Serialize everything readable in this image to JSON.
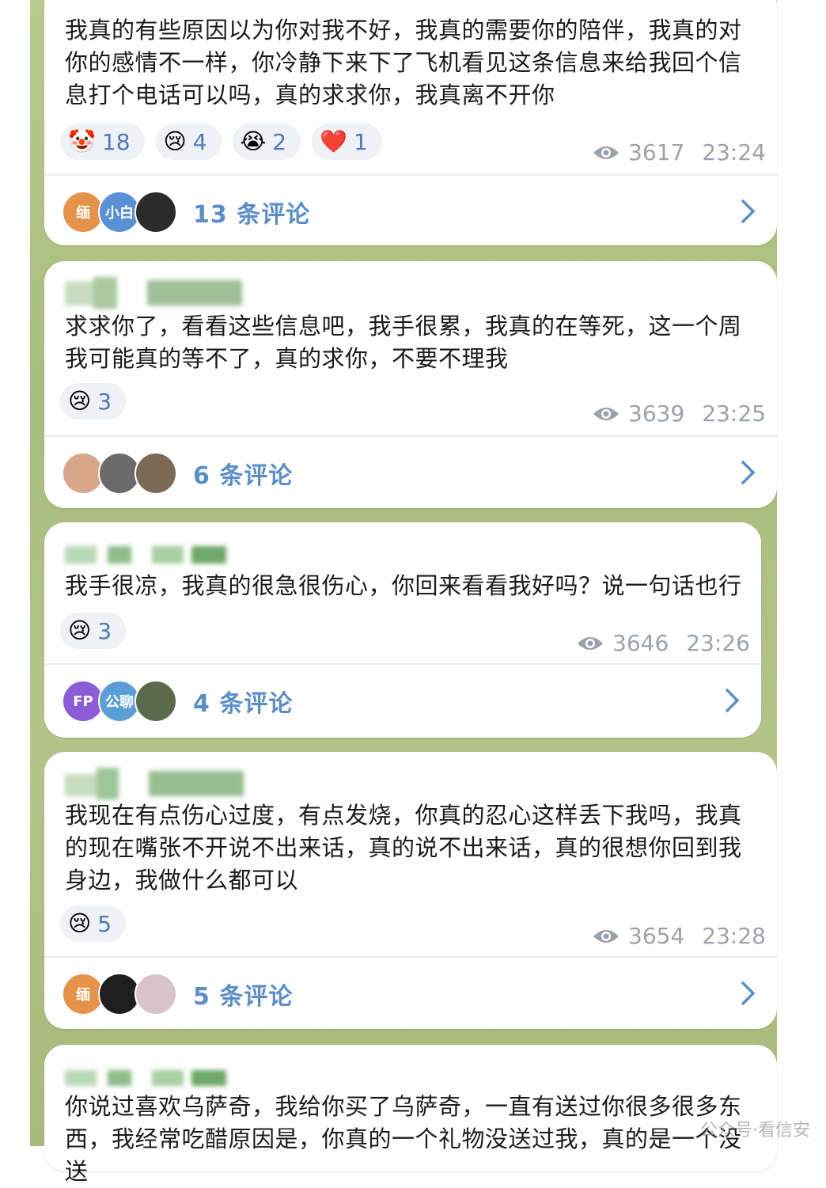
{
  "posts": [
    {
      "message": "我真的有些原因以为你对我不好，我真的需要你的陪伴，我真的对你的感情不一样，你冷静下来下了飞机看见这条信息来给我回个信息打个电话可以吗，真的求求你，我真离不开你",
      "reactions": [
        {
          "emoji": "🤡",
          "count": "18"
        },
        {
          "emoji": "😢",
          "count": "4"
        },
        {
          "emoji": "😭",
          "count": "2"
        },
        {
          "emoji": "❤️",
          "count": "1"
        }
      ],
      "views": "3617",
      "time": "23:24",
      "comments_label": "13 条评论",
      "avatars": [
        {
          "text": "缅",
          "color": "#e7924a"
        },
        {
          "text": "小白",
          "color": "#5b8fd6"
        },
        {
          "text": "",
          "color": "#2b2b2b"
        }
      ]
    },
    {
      "message": "求求你了，看看这些信息吧，我手很累，我真的在等死，这一个周我可能真的等不了，真的求你，不要不理我",
      "reactions": [
        {
          "emoji": "😢",
          "count": "3"
        }
      ],
      "views": "3639",
      "time": "23:25",
      "comments_label": "6 条评论",
      "avatars": [
        {
          "text": "",
          "color": "#d9a58b"
        },
        {
          "text": "",
          "color": "#6a6a6a"
        },
        {
          "text": "",
          "color": "#7b6a55"
        }
      ]
    },
    {
      "message": "我手很凉，我真的很急很伤心，你回来看看我好吗？说一句话也行",
      "reactions": [
        {
          "emoji": "😢",
          "count": "3"
        }
      ],
      "views": "3646",
      "time": "23:26",
      "comments_label": "4 条评论",
      "avatars": [
        {
          "text": "FP",
          "color": "#8c5bd6"
        },
        {
          "text": "公聊",
          "color": "#5b9fd6"
        },
        {
          "text": "",
          "color": "#5a6a4a"
        }
      ]
    },
    {
      "message": "我现在有点伤心过度，有点发烧，你真的忍心这样丢下我吗，我真的现在嘴张不开说不出来话，真的说不出来话，真的很想你回到我身边，我做什么都可以",
      "reactions": [
        {
          "emoji": "😢",
          "count": "5"
        }
      ],
      "views": "3654",
      "time": "23:28",
      "comments_label": "5 条评论",
      "avatars": [
        {
          "text": "缅",
          "color": "#e7924a"
        },
        {
          "text": "",
          "color": "#1f1f1f"
        },
        {
          "text": "",
          "color": "#d8c3c8"
        }
      ]
    },
    {
      "message": "你说过喜欢乌萨奇，我给你买了乌萨奇，一直有送过你很多很多东西，我经常吃醋原因是，你真的一个礼物没送过我，真的是一个没送"
    }
  ],
  "watermark": "公众号·看信安"
}
